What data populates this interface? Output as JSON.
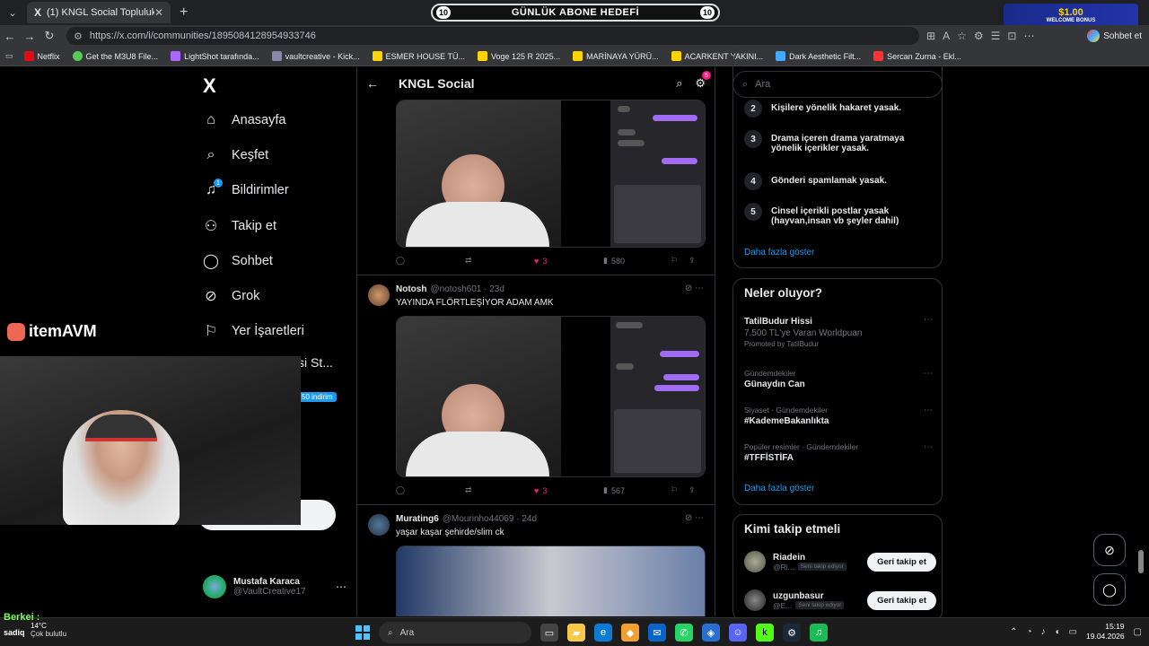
{
  "browser": {
    "tab_title": "(1) KNGL Social Topluluk / X",
    "tab_favicon": "X",
    "url": "https://x.com/i/communities/1895084128954933746",
    "chat_label": "Sohbet et",
    "bookmarks": [
      {
        "label": "Netflix",
        "color": "#e50914"
      },
      {
        "label": "Get the M3U8 File...",
        "color": "#5c5"
      },
      {
        "label": "LightShot tarafında...",
        "color": "#a6f"
      },
      {
        "label": "vaultcreative - Kick...",
        "color": "#88a"
      },
      {
        "label": "ESMER HOUSE TÜ...",
        "color": "#ffd400"
      },
      {
        "label": "Voge 125 R 2025...",
        "color": "#ffd400"
      },
      {
        "label": "MARİNAYA YÜRÜ...",
        "color": "#ffd400"
      },
      {
        "label": "ACARKENT YAKINI...",
        "color": "#ffd400"
      },
      {
        "label": "Dark Aesthetic Filt...",
        "color": "#4af"
      },
      {
        "label": "Sercan Zurna - Ekl...",
        "color": "#f33"
      }
    ]
  },
  "overlay": {
    "goal_left": "10",
    "goal_label": "GÜNLÜK ABONE HEDEFİ",
    "goal_right": "10",
    "bonus_amount": "$1.00",
    "bonus_label": "WELCOME BONUS",
    "brand_item": "item",
    "brand_avm": "AVM",
    "discount_label": "50 indirim",
    "partial_nav": "si St...",
    "chat_user": "Berkei :",
    "chat_user2": "sadiq"
  },
  "leftnav": {
    "logo": "X",
    "items": [
      {
        "label": "Anasayfa",
        "icon": "⌂"
      },
      {
        "label": "Keşfet",
        "icon": "⌕"
      },
      {
        "label": "Bildirimler",
        "icon": "🔔"
      },
      {
        "label": "Takip et",
        "icon": "👤"
      },
      {
        "label": "Sohbet",
        "icon": "◯"
      },
      {
        "label": "Grok",
        "icon": "⊘"
      },
      {
        "label": "Yer İşaretleri",
        "icon": "⚐"
      }
    ],
    "notif_badge": "1",
    "profile_name": "Mustafa Karaca",
    "profile_handle": "@VaultCreative17"
  },
  "feed": {
    "title": "KNGL Social",
    "settings_badge": "5",
    "tweets": [
      {
        "likes": "3",
        "views": "580"
      },
      {
        "name": "Notosh",
        "handle": "@notosh601 · 23d",
        "text": "YAYINDA FLÖRTLEŞİYOR ADAM AMK",
        "likes": "3",
        "views": "567"
      },
      {
        "name": "Murating6",
        "handle": "@Mourinho44069 · 24d",
        "text": "yaşar kaşar şehirde/slim ck"
      }
    ]
  },
  "right": {
    "search_placeholder": "Ara",
    "rules": [
      {
        "n": "2",
        "text": "Kişilere yönelik hakaret yasak."
      },
      {
        "n": "3",
        "text": "Drama içeren drama yaratmaya yönelik içerikler yasak."
      },
      {
        "n": "4",
        "text": "Gönderi spamlamak yasak."
      },
      {
        "n": "5",
        "text": "Cinsel içerikli postlar yasak (hayvan,insan vb şeyler dahil)"
      }
    ],
    "show_more": "Daha fazla göster",
    "trends_title": "Neler oluyor?",
    "trends": [
      {
        "ctx": "",
        "title": "TatilBudur Hissi",
        "sub": "7.500 TL'ye Varan Worldpuan",
        "promo": "Promoted by TatilBudur"
      },
      {
        "ctx": "Gündemdekiler",
        "title": "Günaydın Can",
        "sub": "",
        "promo": ""
      },
      {
        "ctx": "Siyaset · Gündemdekiler",
        "title": "#KademeBakanlıkta",
        "sub": "",
        "promo": ""
      },
      {
        "ctx": "Popüler resimler · Gündemdekiler",
        "title": "#TFFİSTİFA",
        "sub": "",
        "promo": ""
      }
    ],
    "trends_more": "Daha fazla göster",
    "who_title": "Kimi takip etmeli",
    "who": [
      {
        "name": "Riadein",
        "handle": "@Ri...",
        "tag": "Seni takip ediyor",
        "button": "Geri takip et"
      },
      {
        "name": "uzgunbasur",
        "handle": "@E...",
        "tag": "Seni takip ediyor",
        "button": "Geri takip et"
      }
    ]
  },
  "taskbar": {
    "search_placeholder": "Ara",
    "temp": "14°C",
    "weather_text": "Çok bulutlu",
    "time": "15:19",
    "date": "19.04.2026"
  }
}
